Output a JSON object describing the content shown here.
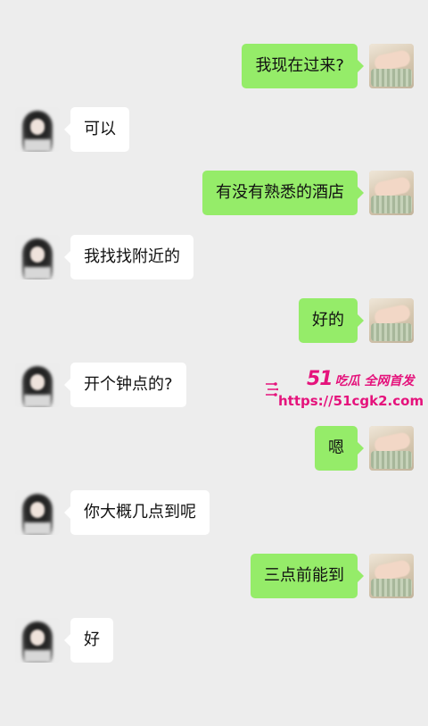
{
  "messages": [
    {
      "side": "out",
      "text": "我现在过来?"
    },
    {
      "side": "in",
      "text": "可以"
    },
    {
      "side": "out",
      "text": "有没有熟悉的酒店"
    },
    {
      "side": "in",
      "text": "我找找附近的"
    },
    {
      "side": "out",
      "text": "好的"
    },
    {
      "side": "in",
      "text": "开个钟点的?"
    },
    {
      "side": "out",
      "text": "嗯"
    },
    {
      "side": "in",
      "text": "你大概几点到呢"
    },
    {
      "side": "out",
      "text": "三点前能到"
    },
    {
      "side": "in",
      "text": "好"
    }
  ],
  "watermark": {
    "number": "51",
    "name": "吃瓜 全网首发",
    "url": "https://51cgk2.com",
    "color": "#e5137c"
  },
  "colors": {
    "background": "#ededed",
    "outgoing_bubble": "#95ec69",
    "incoming_bubble": "#ffffff"
  },
  "icons": {
    "incoming_avatar": "blurred-avatar-icon",
    "outgoing_avatar": "photo-avatar-icon"
  }
}
